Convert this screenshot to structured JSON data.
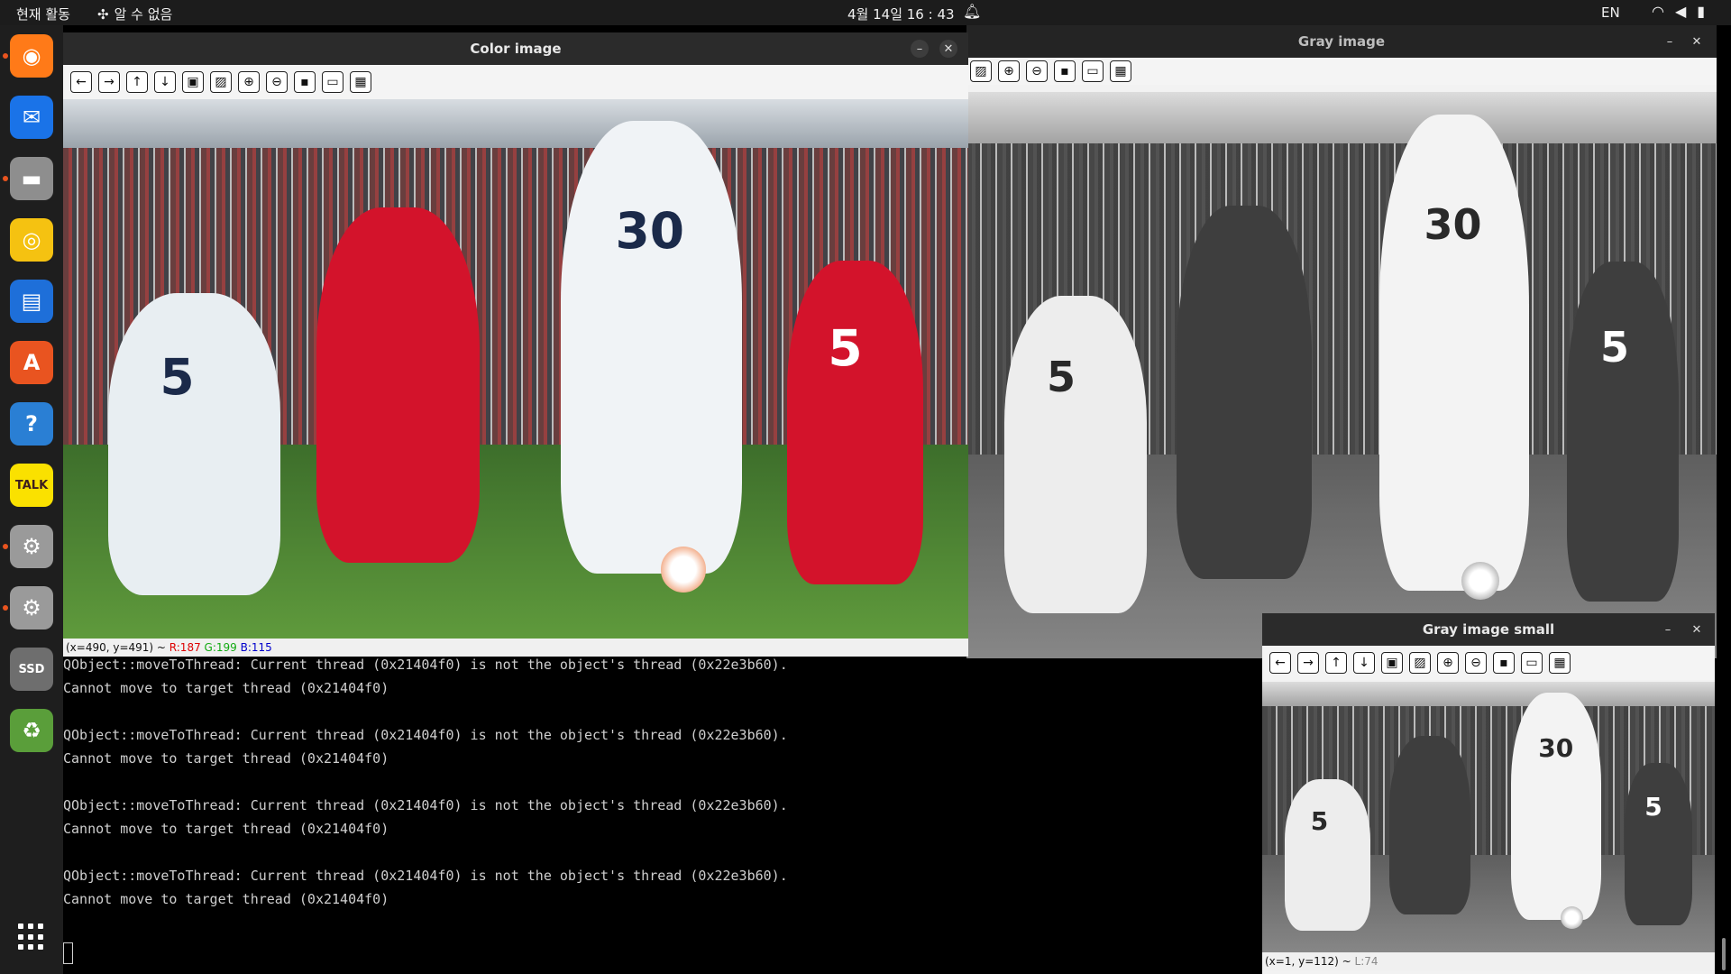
{
  "topbar": {
    "activities": "현재 활동",
    "app_name": "알 수 없음",
    "clock": "4월 14일  16 : 43",
    "language": "EN"
  },
  "dock": {
    "items": [
      {
        "name": "firefox",
        "icon": "firefox-icon",
        "running": true,
        "color": "#ff7a18"
      },
      {
        "name": "thunderbird",
        "icon": "thunderbird-icon",
        "running": false,
        "color": "#1a73e8"
      },
      {
        "name": "files",
        "icon": "folder-icon",
        "running": true,
        "color": "#8e8e8e"
      },
      {
        "name": "rhythmbox",
        "icon": "music-icon",
        "running": false,
        "color": "#f5c211"
      },
      {
        "name": "writer",
        "icon": "document-icon",
        "running": false,
        "color": "#1e6fd9"
      },
      {
        "name": "app-center",
        "icon": "app-store-icon",
        "running": false,
        "color": "#e95420"
      },
      {
        "name": "help",
        "icon": "help-icon",
        "running": false,
        "color": "#2a7fd4"
      },
      {
        "name": "kakaotalk",
        "icon": "talk-icon",
        "running": false,
        "color": "#fae100",
        "label": "TALK"
      },
      {
        "name": "settings-1",
        "icon": "gear-icon",
        "running": true,
        "color": "#9a9a9a"
      },
      {
        "name": "settings-2",
        "icon": "gear-icon",
        "running": true,
        "color": "#9a9a9a"
      },
      {
        "name": "ssd",
        "icon": "disk-icon",
        "running": false,
        "color": "#6e6e6e",
        "label": "SSD"
      },
      {
        "name": "trash",
        "icon": "trash-icon",
        "running": false,
        "color": "#5a9e3a"
      }
    ],
    "apps_grid_icon": "apps-grid-icon"
  },
  "windows": {
    "color_image": {
      "title": "Color image",
      "status_coords": "(x=490, y=491) ~ ",
      "status_r": "R:187",
      "status_g": "G:199",
      "status_b": "B:115"
    },
    "gray_image": {
      "title": "Gray image"
    },
    "gray_small": {
      "title": "Gray image small",
      "status_coords": "(x=1, y=112) ~ ",
      "status_l": "L:74"
    }
  },
  "toolbar_icons": [
    "arrow-left-icon",
    "arrow-right-icon",
    "arrow-up-icon",
    "arrow-down-icon",
    "zoom-fit-icon",
    "zoom-original-icon",
    "zoom-in-icon",
    "zoom-out-icon",
    "save-icon",
    "copy-icon",
    "properties-icon"
  ],
  "terminal": {
    "lines": [
      "QObject::moveToThread: Current thread (0x21404f0) is not the object's thread (0x22e3b60).",
      "Cannot move to target thread (0x21404f0)",
      "",
      "QObject::moveToThread: Current thread (0x21404f0) is not the object's thread (0x22e3b60).",
      "Cannot move to target thread (0x21404f0)",
      "",
      "QObject::moveToThread: Current thread (0x21404f0) is not the object's thread (0x22e3b60).",
      "Cannot move to target thread (0x21404f0)",
      "",
      "QObject::moveToThread: Current thread (0x21404f0) is not the object's thread (0x22e3b60).",
      "Cannot move to target thread (0x21404f0)"
    ]
  },
  "scene": {
    "jersey_numbers": [
      "5",
      "30",
      "5"
    ]
  }
}
